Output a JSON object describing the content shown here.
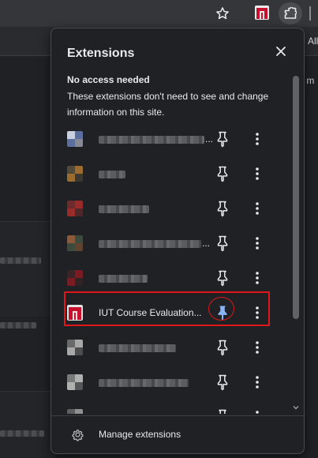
{
  "toolbar": {
    "star_icon": "star-outline-icon",
    "extension_icon": "iut-extension-icon",
    "puzzle_icon": "puzzle-piece-icon"
  },
  "bookmarks": {
    "partial_text": "All"
  },
  "page": {
    "partial_text": "r m"
  },
  "popup": {
    "title": "Extensions",
    "close_icon": "close-icon",
    "section": {
      "title": "No access needed",
      "description": "These extensions don't need to see and change information on this site."
    },
    "extensions": [
      {
        "name": "",
        "blurred": true,
        "suffix": "...",
        "pinned": false,
        "icon_colors": [
          "#5a6f9e",
          "#c9d0e0"
        ]
      },
      {
        "name": "",
        "blurred": true,
        "pinned": false,
        "icon_colors": [
          "#9c6b2e",
          "#4f4a3a"
        ]
      },
      {
        "name": "",
        "blurred": true,
        "pinned": false,
        "icon_colors": [
          "#9a2b2b",
          "#6e2b2b"
        ]
      },
      {
        "name": "",
        "blurred": true,
        "suffix": "...",
        "pinned": false,
        "icon_colors": [
          "#3c4b3e",
          "#8c5a3a"
        ]
      },
      {
        "name": "",
        "blurred": true,
        "pinned": false,
        "icon_colors": [
          "#7a1c22",
          "#3a2428"
        ]
      },
      {
        "name": "IUT Course Evaluation...",
        "blurred": false,
        "pinned": true,
        "icon_colors": [
          "#e3e3e3",
          "#c8102e"
        ]
      },
      {
        "name": "",
        "blurred": true,
        "pinned": false,
        "icon_colors": [
          "#a8a8a8",
          "#6a6a6a"
        ]
      },
      {
        "name": "",
        "blurred": true,
        "pinned": false,
        "icon_colors": [
          "#b0b0b0",
          "#7a7a7a"
        ]
      },
      {
        "name": "",
        "blurred": true,
        "pinned": false,
        "icon_colors": [
          "#909090",
          "#5e5e5e"
        ]
      }
    ],
    "manage": {
      "label": "Manage extensions",
      "icon": "gear-icon"
    }
  },
  "colors": {
    "accent_pin": "#8ab4f8",
    "highlight": "#e0161a",
    "popup_bg": "#202124"
  }
}
